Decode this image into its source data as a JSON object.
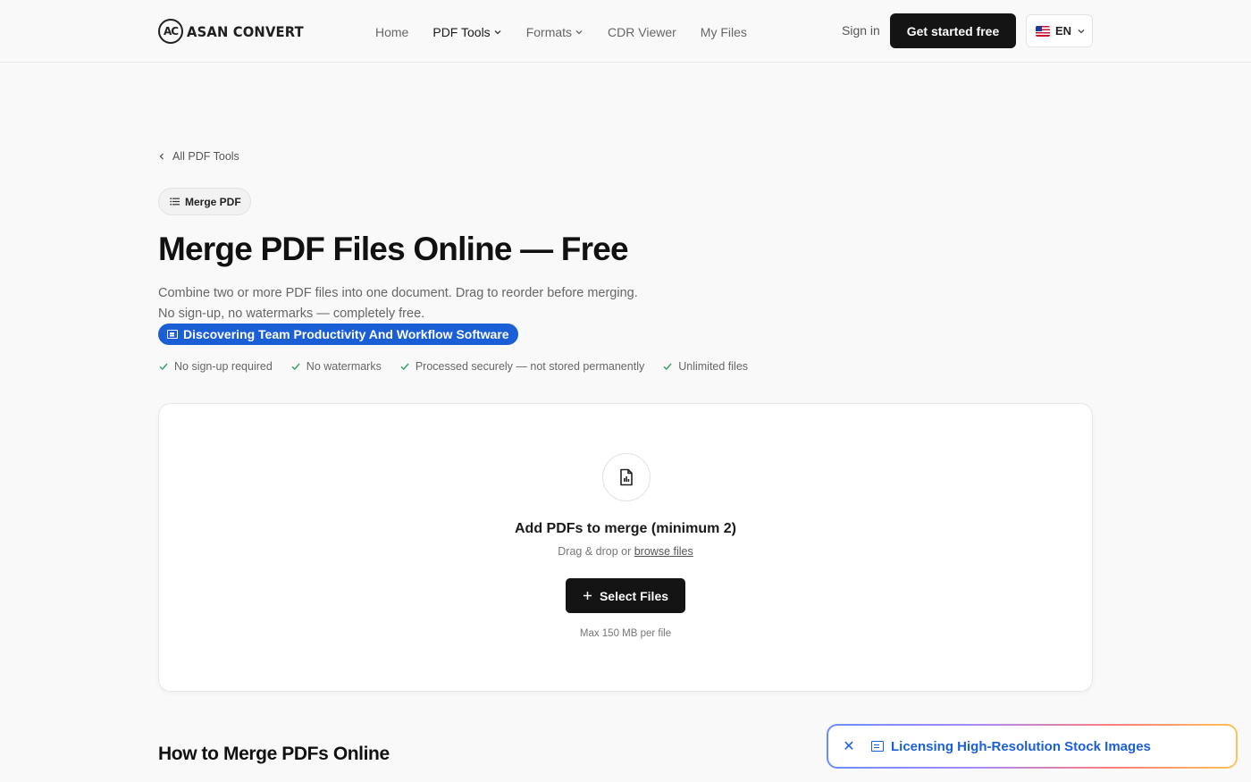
{
  "header": {
    "logo_mark": "AC",
    "logo_text": "ASAN CONVERT",
    "nav": [
      {
        "label": "Home"
      },
      {
        "label": "PDF Tools"
      },
      {
        "label": "Formats"
      },
      {
        "label": "CDR Viewer"
      },
      {
        "label": "My Files"
      }
    ],
    "sign_in": "Sign in",
    "cta": "Get started free",
    "language": "EN"
  },
  "hero": {
    "back_link": "All PDF Tools",
    "tool_badge": "Merge PDF",
    "title": "Merge PDF Files Online — Free",
    "subtitle_line1": "Combine two or more PDF files into one document. Drag to reorder before merging.",
    "subtitle_line2": "No sign-up, no watermarks — completely free.",
    "ad_link": "Discovering Team Productivity And Workflow Software",
    "checks": [
      "No sign-up required",
      "No watermarks",
      "Processed securely — not stored permanently",
      "Unlimited files"
    ]
  },
  "dropzone": {
    "title": "Add PDFs to merge (minimum 2)",
    "drag_text": "Drag & drop or",
    "browse_link": "browse files",
    "button": "Select Files",
    "max_size": "Max 150 MB per file"
  },
  "how_heading": "How to Merge PDFs Online",
  "floating_ad": {
    "text": "Licensing High-Resolution Stock Images"
  },
  "colors": {
    "accent_blue": "#1b5fd6",
    "dark_button": "#141414",
    "check_green": "#3aa36a"
  }
}
